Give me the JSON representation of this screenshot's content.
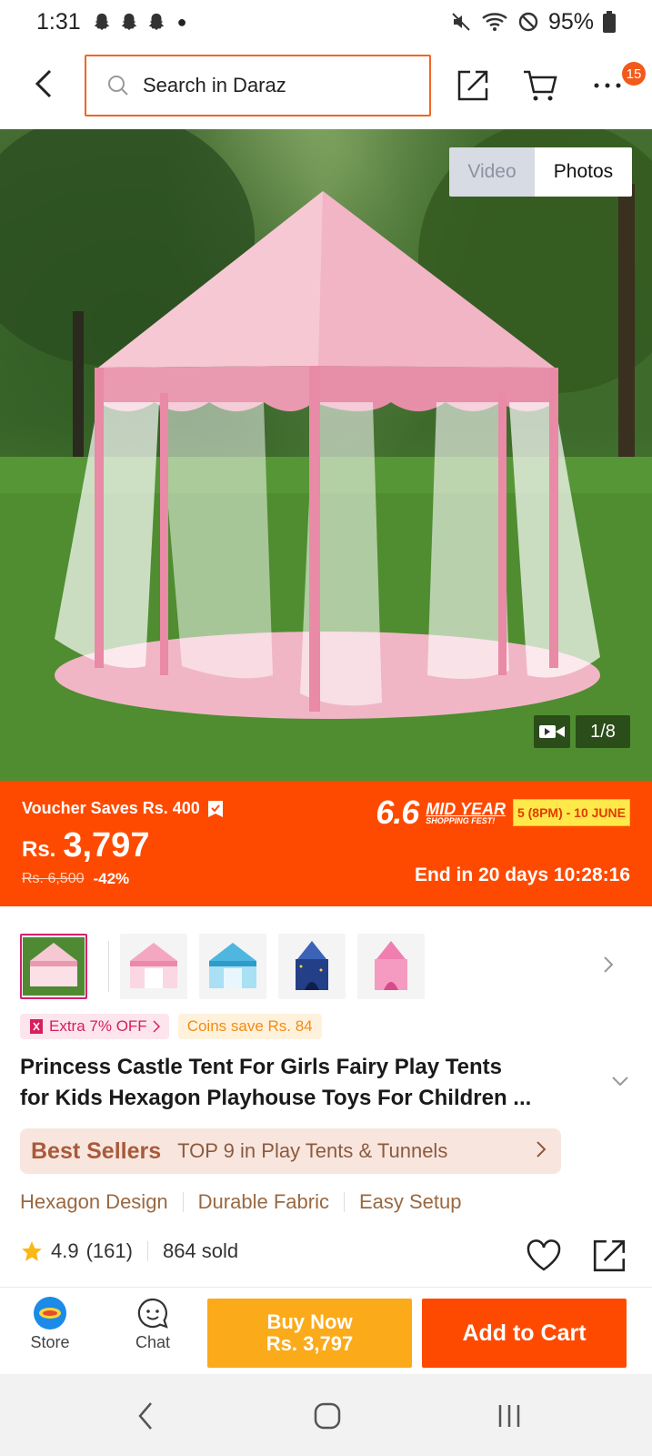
{
  "status_bar": {
    "time": "1:31",
    "battery": "95%",
    "icons": [
      "snapchat-ghost-icon",
      "snapchat-ghost-icon",
      "snapchat-ghost-icon",
      "dot-icon",
      "mute-icon",
      "wifi-icon",
      "do-not-disturb-icon",
      "battery-icon"
    ]
  },
  "header": {
    "search_placeholder": "Search in Daraz",
    "more_badge": "15",
    "accent": "#f26522"
  },
  "hero": {
    "tab_video": "Video",
    "tab_photos": "Photos",
    "image_counter": "1/8"
  },
  "price_banner": {
    "voucher": "Voucher Saves Rs. 400",
    "currency": "Rs.",
    "price": "3,797",
    "original_price": "Rs. 6,500",
    "discount": "-42%",
    "campaign_number": "6.6",
    "campaign_title": "MID YEAR",
    "campaign_subtitle": "SHOPPING FEST!",
    "campaign_date": "5 (8PM) - 10 JUNE",
    "end_timer": "End in 20 days 10:28:16",
    "color": "#fe4a00"
  },
  "thumbnails": [
    {
      "name": "pink-hexagon-tent"
    },
    {
      "name": "pink-hexagon-tent-white"
    },
    {
      "name": "blue-hexagon-tent"
    },
    {
      "name": "navy-castle-tent"
    },
    {
      "name": "pink-castle-tent"
    }
  ],
  "tags": {
    "extra_off": "Extra 7% OFF",
    "coins": "Coins save Rs. 84"
  },
  "product": {
    "title_line1": "Princess Castle Tent For Girls Fairy Play Tents",
    "title_line2": "for Kids Hexagon Playhouse Toys For Children ..."
  },
  "best_sellers": {
    "brand": "Best Sellers",
    "text": "TOP 9 in Play Tents & Tunnels"
  },
  "features": [
    "Hexagon Design",
    "Durable Fabric",
    "Easy Setup"
  ],
  "rating": {
    "score": "4.9",
    "count": "(161)",
    "sold": "864 sold"
  },
  "bottom_bar": {
    "store": "Store",
    "chat": "Chat",
    "buy_now_line1": "Buy Now",
    "buy_now_line2": "Rs. 3,797",
    "add_to_cart": "Add to Cart",
    "buy_color": "#fbaa1a",
    "cart_color": "#fe4a00"
  }
}
